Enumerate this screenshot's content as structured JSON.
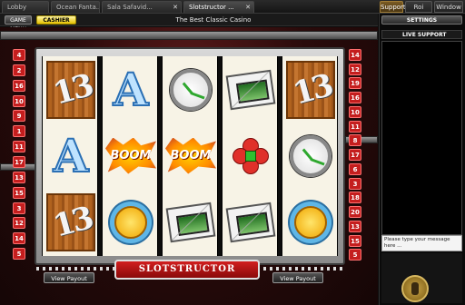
{
  "tabs": [
    {
      "label": "Lobby"
    },
    {
      "label": "Ocean Fanta..."
    },
    {
      "label": "Sala Safavid..."
    },
    {
      "label": "Slotstructor ..."
    }
  ],
  "right_tabs": [
    {
      "label": "Support"
    },
    {
      "label": "Roi"
    },
    {
      "label": "Window"
    }
  ],
  "toolbar": {
    "menu_label": "GAME MENU",
    "cashier_label": "CASHIER",
    "title": "The Best Classic Casino"
  },
  "side_panel": {
    "settings_label": "SETTINGS",
    "live_support_label": "LIVE SUPPORT",
    "message_placeholder": "Please type your message here ..."
  },
  "game": {
    "logo_text": "SLOTSTRUCTOR",
    "view_payout_left": "View Payout",
    "view_payout_right": "View Payout",
    "left_lines": [
      "4",
      "2",
      "16",
      "10",
      "9",
      "1",
      "11",
      "17",
      "13",
      "15",
      "3",
      "12",
      "14",
      "5"
    ],
    "right_lines": [
      "14",
      "12",
      "19",
      "16",
      "10",
      "11",
      "8",
      "17",
      "6",
      "3",
      "18",
      "20",
      "13",
      "15",
      "5"
    ],
    "reels": [
      [
        "13-wood",
        "A",
        "13-wood"
      ],
      [
        "A",
        "boom",
        "sun"
      ],
      [
        "clock",
        "boom",
        "envelope"
      ],
      [
        "envelope",
        "clover",
        "envelope"
      ],
      [
        "13-wood",
        "clock",
        "sun"
      ]
    ],
    "symbol_texts": {
      "wood": "13",
      "ace": "A",
      "boom": "BOOM"
    }
  }
}
